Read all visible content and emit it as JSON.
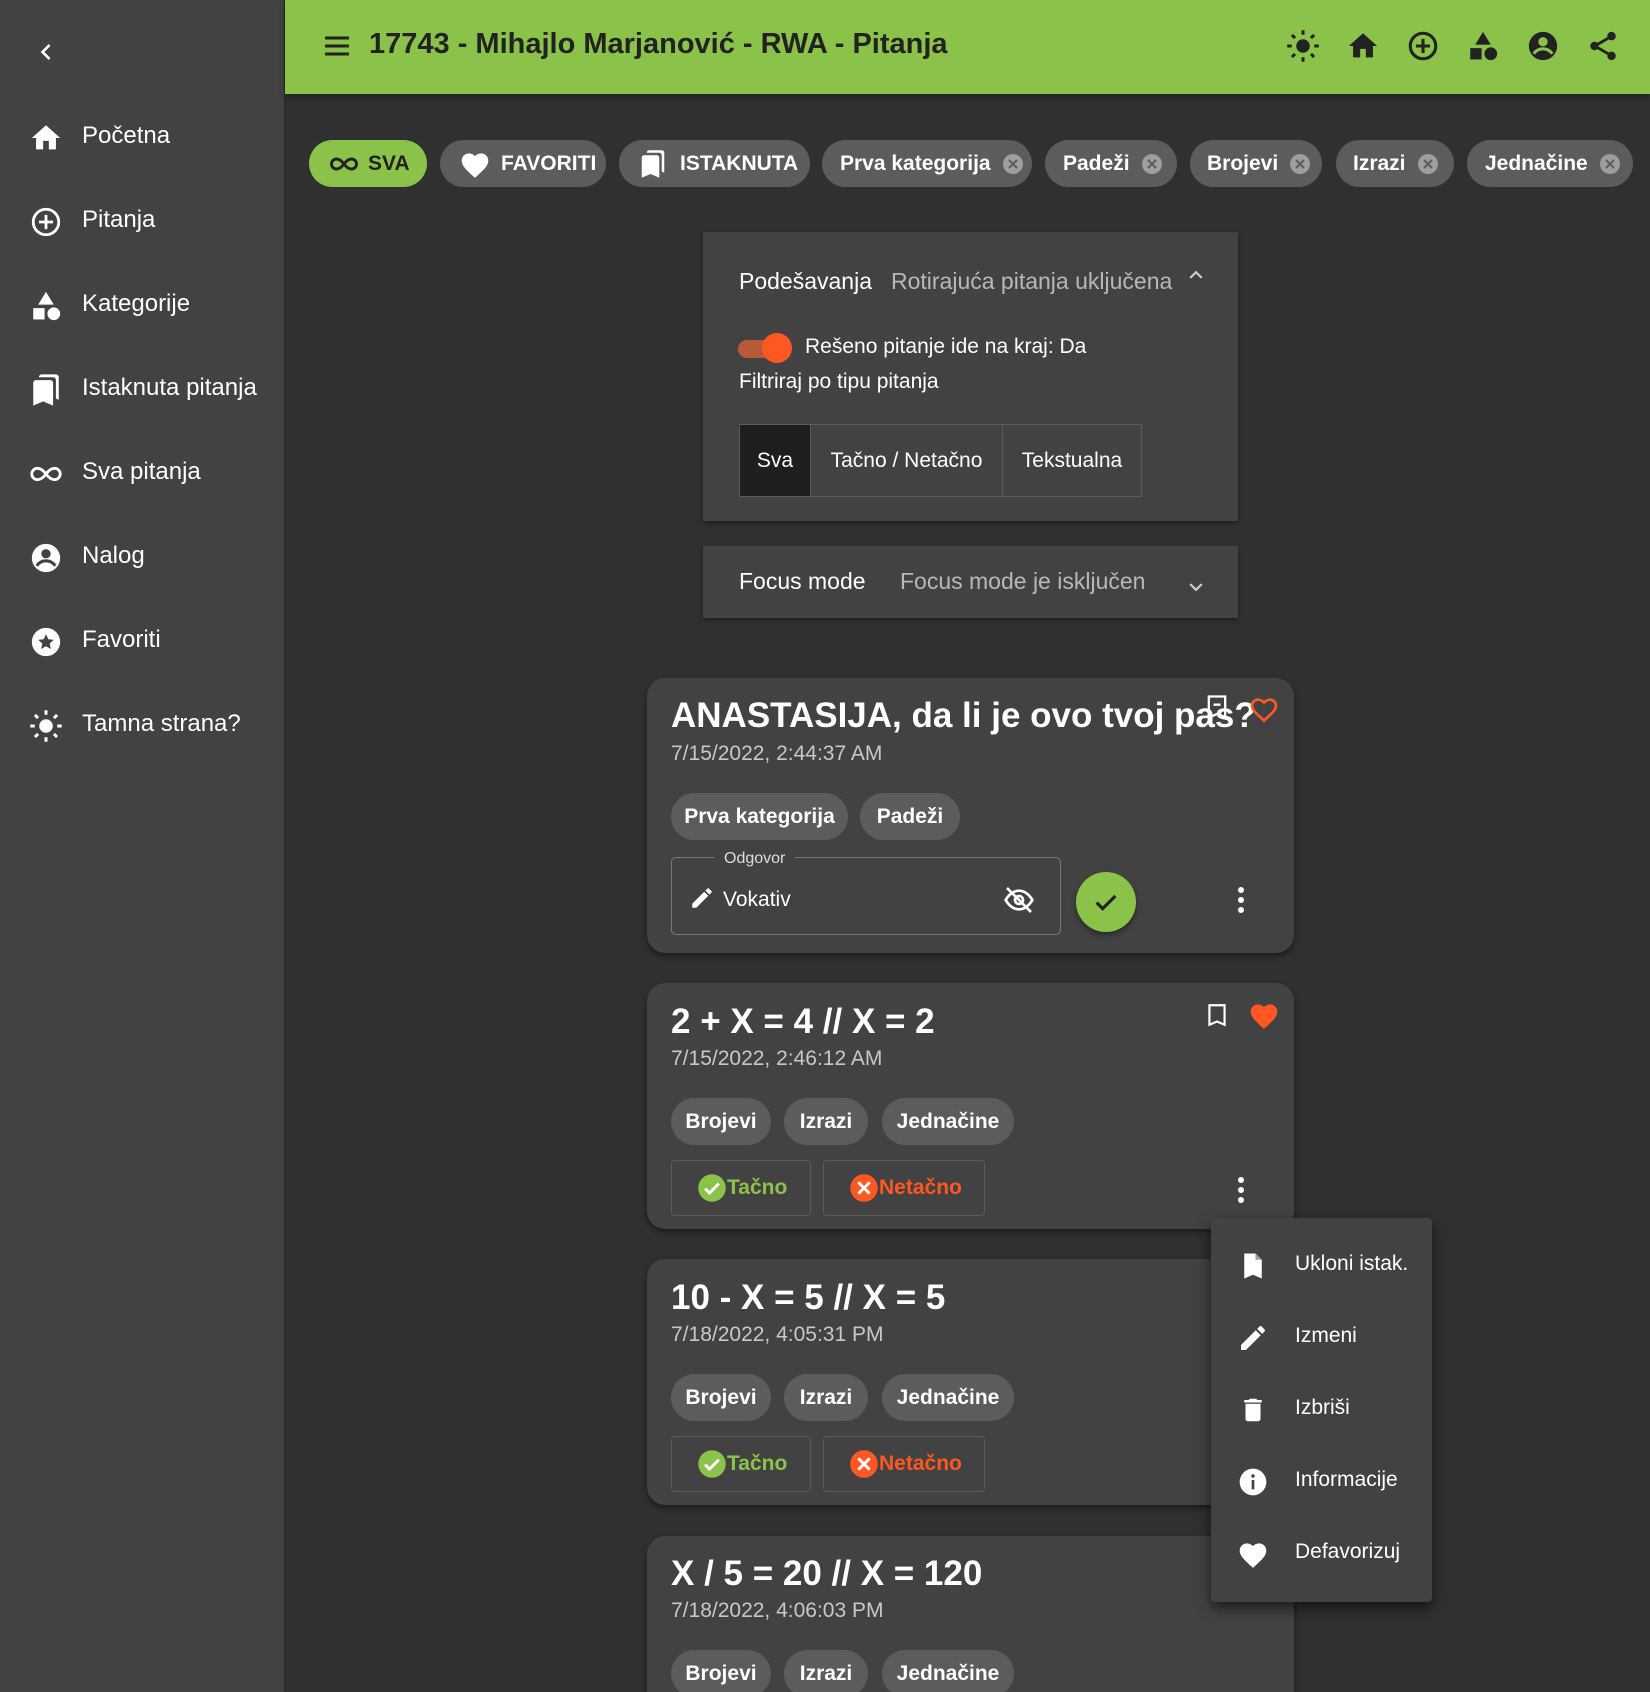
{
  "colors": {
    "accent": "#8bc34a",
    "warning": "#ff5722",
    "surface": "#424242",
    "background": "#303030"
  },
  "sidebar": {
    "back_icon": "chevron-left-icon",
    "items": [
      {
        "label": "Početna",
        "icon": "home-icon"
      },
      {
        "label": "Pitanja",
        "icon": "add-circle-icon"
      },
      {
        "label": "Kategorije",
        "icon": "category-icon"
      },
      {
        "label": "Istaknuta pitanja",
        "icon": "bookmarks-icon"
      },
      {
        "label": "Sva pitanja",
        "icon": "infinity-icon"
      },
      {
        "label": "Nalog",
        "icon": "account-icon"
      },
      {
        "label": "Favoriti",
        "icon": "star-circle-icon"
      },
      {
        "label": "Tamna strana?",
        "icon": "sun-icon"
      }
    ]
  },
  "header": {
    "title": "17743 - Mihajlo Marjanović - RWA - Pitanja",
    "icons": [
      "sun-icon",
      "home-icon",
      "add-circle-icon",
      "category-icon",
      "account-icon",
      "share-icon"
    ]
  },
  "filters": [
    {
      "label": "SVA",
      "icon": "infinity-icon",
      "selected": true
    },
    {
      "label": "FAVORITI",
      "icon": "heart-icon"
    },
    {
      "label": "ISTAKNUTA",
      "icon": "bookmarks-icon"
    },
    {
      "label": "Prva kategorija",
      "removable": true
    },
    {
      "label": "Padeži",
      "removable": true
    },
    {
      "label": "Brojevi",
      "removable": true
    },
    {
      "label": "Izrazi",
      "removable": true
    },
    {
      "label": "Jednačine",
      "removable": true
    }
  ],
  "settings": {
    "title": "Podešavanja",
    "summary": "Rotirajuća pitanja uključena",
    "toggle_label": "Rešeno pitanje ide na kraj: Da",
    "toggle_on": true,
    "filter_label": "Filtriraj po tipu pitanja",
    "segments": [
      "Sva",
      "Tačno / Netačno",
      "Tekstualna"
    ],
    "selected_segment": "Sva"
  },
  "focus": {
    "title": "Focus mode",
    "summary": "Focus mode je isključen"
  },
  "questions": [
    {
      "title": "ANASTASIJA, da li je ovo tvoj pas?",
      "date": "7/15/2022, 2:44:37 AM",
      "tags": [
        "Prva kategorija",
        "Padeži"
      ],
      "type": "text",
      "answer_label": "Odgovor",
      "answer_value": "Vokativ",
      "favorite": false,
      "bookmarked": true
    },
    {
      "title": "2 + X = 4 // X = 2",
      "date": "7/15/2022, 2:46:12 AM",
      "tags": [
        "Brojevi",
        "Izrazi",
        "Jednačine"
      ],
      "type": "truefalse",
      "true_label": "Tačno",
      "false_label": "Netačno",
      "favorite": true,
      "bookmarked": false
    },
    {
      "title": "10 - X = 5 // X = 5",
      "date": "7/18/2022, 4:05:31 PM",
      "tags": [
        "Brojevi",
        "Izrazi",
        "Jednačine"
      ],
      "type": "truefalse",
      "true_label": "Tačno",
      "false_label": "Netačno"
    },
    {
      "title": "X / 5 = 20 // X = 120",
      "date": "7/18/2022, 4:06:03 PM",
      "tags": [
        "Brojevi",
        "Izrazi",
        "Jednačine"
      ]
    }
  ],
  "context_menu": [
    {
      "label": "Ukloni istak.",
      "icon": "bookmark-remove-icon"
    },
    {
      "label": "Izmeni",
      "icon": "pencil-icon"
    },
    {
      "label": "Izbriši",
      "icon": "trash-icon"
    },
    {
      "label": "Informacije",
      "icon": "info-icon"
    },
    {
      "label": "Defavorizuj",
      "icon": "heart-icon"
    }
  ]
}
